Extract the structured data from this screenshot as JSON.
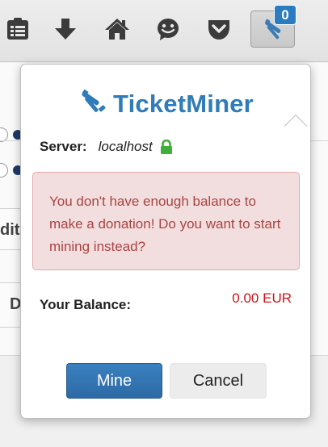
{
  "toolbar": {
    "items": [
      {
        "name": "reader-list-icon"
      },
      {
        "name": "download-arrow-icon"
      },
      {
        "name": "home-icon"
      },
      {
        "name": "smiley-icon"
      },
      {
        "name": "pocket-icon"
      },
      {
        "name": "pickaxe-icon"
      }
    ],
    "badge_count": "0"
  },
  "background": {
    "partial_text_1": "dit",
    "partial_text_2": "D"
  },
  "popup": {
    "brand": "TicketMiner",
    "server_label": "Server:",
    "server_host": "localhost",
    "alert_text": "You don't have enough balance to make a donation! Do you want to start mining instead?",
    "balance_label": "Your Balance:",
    "balance_value": "0.00 EUR",
    "mine_button": "Mine",
    "cancel_button": "Cancel"
  },
  "colors": {
    "brand": "#2f7cb8",
    "badge": "#2a7cc0",
    "alert_bg": "#f2dede",
    "alert_text": "#a94442",
    "balance_value": "#d0121b",
    "lock": "#3fae3a",
    "primary_button": "#2d6aa5"
  }
}
